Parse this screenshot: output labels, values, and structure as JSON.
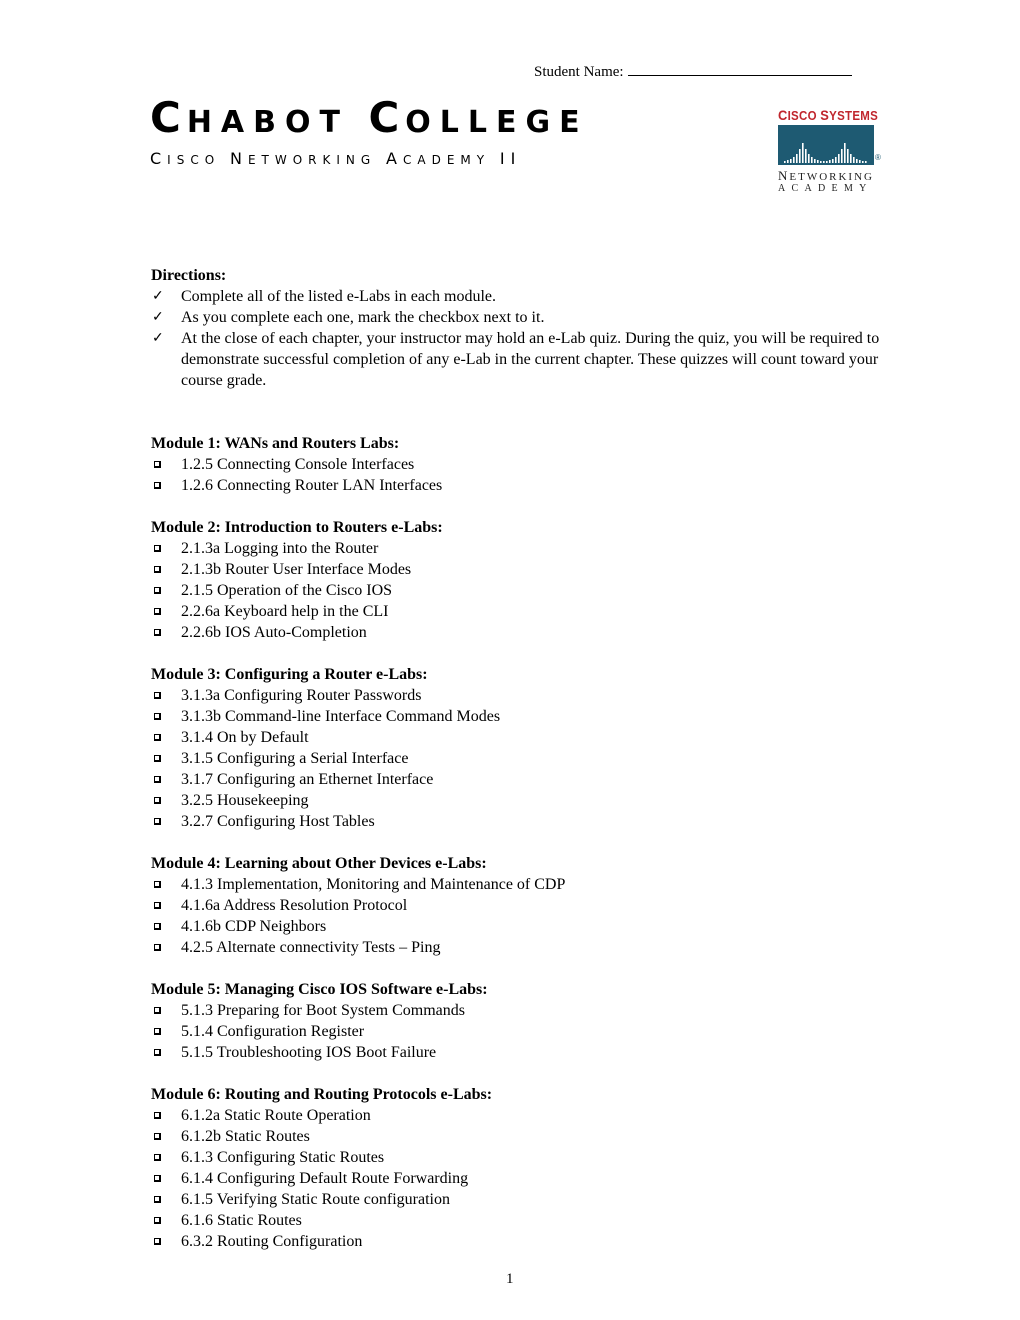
{
  "header": {
    "student_name_label": "Student Name:",
    "title": {
      "first_cap": "C",
      "first_rest": "HABOT",
      "second_cap": "C",
      "second_rest": "OLLEGE"
    },
    "subtitle": {
      "w1_cap": "C",
      "w1_rest": "ISCO",
      "w2_cap": "N",
      "w2_rest": "ETWORKING",
      "w3_cap": "A",
      "w3_rest": "CADEMY",
      "w4": "II"
    },
    "logo": {
      "brand_c": "C",
      "brand_isco": "ISCO",
      "brand_s": "S",
      "brand_ystems": "YSTEMS",
      "registered": "®",
      "line1_cap": "N",
      "line1_rest": "ETWORKING",
      "line2": "ACADEMY",
      "colors": {
        "brand_red": "#c0262d",
        "bar_teal": "#1e5a72"
      }
    }
  },
  "directions": {
    "heading": "Directions:",
    "check_icon": "✓",
    "items": [
      "Complete all of the listed e-Labs in each module.",
      "As you complete each one, mark the checkbox next to it.",
      "At the close of each chapter, your instructor may hold an e-Lab quiz.  During the quiz, you will be required to demonstrate successful completion of any e-Lab in the current chapter.   These quizzes will count toward your course grade."
    ]
  },
  "modules": [
    {
      "heading": "Module 1: WANs and Routers Labs:",
      "labs": [
        "1.2.5 Connecting Console Interfaces",
        "1.2.6 Connecting Router LAN Interfaces"
      ]
    },
    {
      "heading": "Module 2: Introduction to Routers e-Labs:",
      "labs": [
        "2.1.3a Logging into the Router",
        "2.1.3b Router User Interface Modes",
        "2.1.5 Operation of the Cisco IOS",
        "2.2.6a Keyboard help in the CLI",
        "2.2.6b IOS Auto-Completion"
      ]
    },
    {
      "heading": "Module 3: Configuring a Router e-Labs:",
      "labs": [
        "3.1.3a Configuring Router Passwords",
        "3.1.3b Command-line Interface Command Modes",
        "3.1.4 On by Default",
        "3.1.5 Configuring a Serial Interface",
        "3.1.7 Configuring an Ethernet Interface",
        "3.2.5 Housekeeping",
        "3.2.7 Configuring Host Tables"
      ]
    },
    {
      "heading": "Module 4: Learning about Other Devices e-Labs:",
      "labs": [
        "4.1.3 Implementation, Monitoring and Maintenance of CDP",
        "4.1.6a Address Resolution Protocol",
        "4.1.6b CDP Neighbors",
        "4.2.5 Alternate connectivity Tests – Ping"
      ]
    },
    {
      "heading": "Module 5: Managing Cisco IOS Software e-Labs:",
      "labs": [
        "5.1.3 Preparing for Boot System Commands",
        "5.1.4 Configuration Register",
        "5.1.5 Troubleshooting IOS Boot Failure"
      ]
    },
    {
      "heading": "Module 6: Routing and Routing Protocols e-Labs:",
      "labs": [
        "6.1.2a Static Route Operation",
        "6.1.2b Static Routes",
        "6.1.3 Configuring Static Routes",
        "6.1.4 Configuring Default Route Forwarding",
        "6.1.5 Verifying Static Route configuration",
        "6.1.6 Static Routes",
        "6.3.2 Routing Configuration"
      ]
    }
  ],
  "footer": {
    "page_number": "1"
  }
}
